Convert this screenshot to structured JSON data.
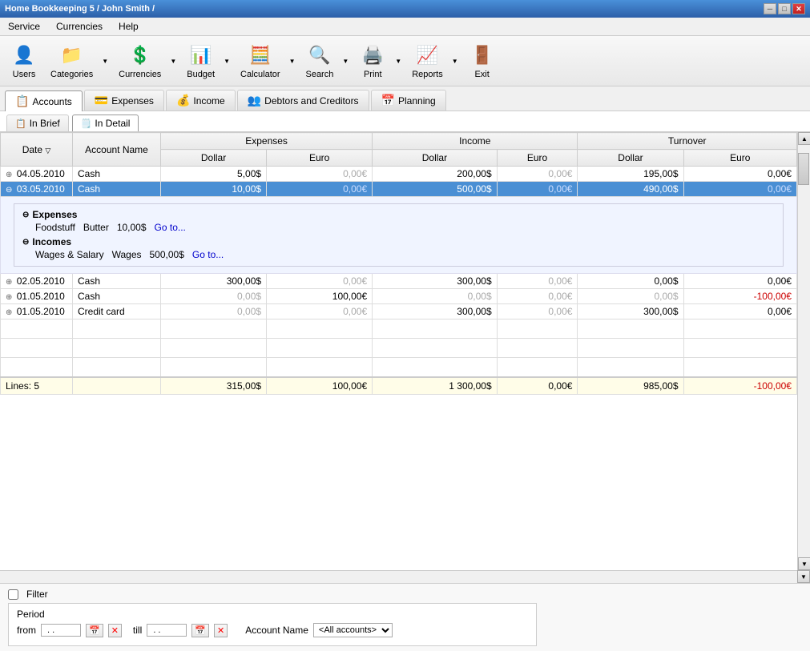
{
  "window": {
    "title": "Home Bookkeeping 5  / John Smith /",
    "controls": [
      "minimize",
      "maximize",
      "close"
    ]
  },
  "menu": {
    "items": [
      "Service",
      "Currencies",
      "Help"
    ]
  },
  "toolbar": {
    "buttons": [
      {
        "id": "users",
        "label": "Users",
        "icon": "👤"
      },
      {
        "id": "categories",
        "label": "Categories",
        "icon": "📁"
      },
      {
        "id": "currencies",
        "label": "Currencies",
        "icon": "💲"
      },
      {
        "id": "budget",
        "label": "Budget",
        "icon": "📊"
      },
      {
        "id": "calculator",
        "label": "Calculator",
        "icon": "🧮"
      },
      {
        "id": "search",
        "label": "Search",
        "icon": "🔍"
      },
      {
        "id": "print",
        "label": "Print",
        "icon": "🖨️"
      },
      {
        "id": "reports",
        "label": "Reports",
        "icon": "📈"
      },
      {
        "id": "exit",
        "label": "Exit",
        "icon": "🚪"
      }
    ]
  },
  "tabs": [
    {
      "id": "accounts",
      "label": "Accounts",
      "icon": "📋",
      "active": true
    },
    {
      "id": "expenses",
      "label": "Expenses",
      "icon": "💳"
    },
    {
      "id": "income",
      "label": "Income",
      "icon": "💰"
    },
    {
      "id": "debtors",
      "label": "Debtors and Creditors",
      "icon": "👥"
    },
    {
      "id": "planning",
      "label": "Planning",
      "icon": "📅"
    }
  ],
  "sub_tabs": [
    {
      "id": "in-brief",
      "label": "In Brief"
    },
    {
      "id": "in-detail",
      "label": "In Detail",
      "active": true
    }
  ],
  "table": {
    "headers": {
      "date": "Date",
      "account_name": "Account Name",
      "expenses_group": "Expenses",
      "income_group": "Income",
      "turnover_group": "Turnover",
      "dollar": "Dollar",
      "euro": "Euro"
    },
    "rows": [
      {
        "date": "04.05.2010",
        "account": "Cash",
        "exp_dollar": "5,00$",
        "exp_euro": "0,00€",
        "inc_dollar": "200,00$",
        "inc_euro": "0,00€",
        "turn_dollar": "195,00$",
        "turn_euro": "0,00€",
        "expanded": false,
        "selected": false
      },
      {
        "date": "03.05.2010",
        "account": "Cash",
        "exp_dollar": "10,00$",
        "exp_euro": "0,00€",
        "inc_dollar": "500,00$",
        "inc_euro": "0,00€",
        "turn_dollar": "490,00$",
        "turn_euro": "0,00€",
        "expanded": true,
        "selected": true,
        "detail": {
          "expenses": [
            {
              "category": "Foodstuff",
              "subcategory": "Butter",
              "amount": "10,00$",
              "link": "Go to..."
            }
          ],
          "incomes": [
            {
              "category": "Wages & Salary",
              "subcategory": "Wages",
              "amount": "500,00$",
              "link": "Go to..."
            }
          ]
        }
      },
      {
        "date": "02.05.2010",
        "account": "Cash",
        "exp_dollar": "300,00$",
        "exp_euro": "0,00€",
        "inc_dollar": "300,00$",
        "inc_euro": "0,00€",
        "turn_dollar": "0,00$",
        "turn_euro": "0,00€",
        "expanded": false,
        "selected": false
      },
      {
        "date": "01.05.2010",
        "account": "Cash",
        "exp_dollar": "0,00$",
        "exp_euro": "100,00€",
        "inc_dollar": "0,00$",
        "inc_euro": "0,00€",
        "turn_dollar": "0,00$",
        "turn_euro": "-100,00€",
        "expanded": false,
        "selected": false
      },
      {
        "date": "01.05.2010",
        "account": "Credit card",
        "exp_dollar": "0,00$",
        "exp_euro": "0,00€",
        "inc_dollar": "300,00$",
        "inc_euro": "0,00€",
        "turn_dollar": "300,00$",
        "turn_euro": "0,00€",
        "expanded": false,
        "selected": false
      }
    ],
    "summary": {
      "label": "Lines: 5",
      "exp_dollar": "315,00$",
      "exp_euro": "100,00€",
      "inc_dollar": "1 300,00$",
      "inc_euro": "0,00€",
      "turn_dollar": "985,00$",
      "turn_euro": "-100,00€"
    }
  },
  "filter": {
    "checkbox_label": "Filter",
    "period_label": "Period",
    "from_label": "from",
    "till_label": "till",
    "from_date": " . . ",
    "till_date": " . . ",
    "account_label": "Account Name",
    "account_value": "<All accounts>"
  },
  "colors": {
    "selected_row_bg": "#4a8fd4",
    "selected_row_text": "#ffffff",
    "gray_value": "#aaaaaa",
    "negative": "#cc0000",
    "summary_bg": "#fffde8"
  }
}
